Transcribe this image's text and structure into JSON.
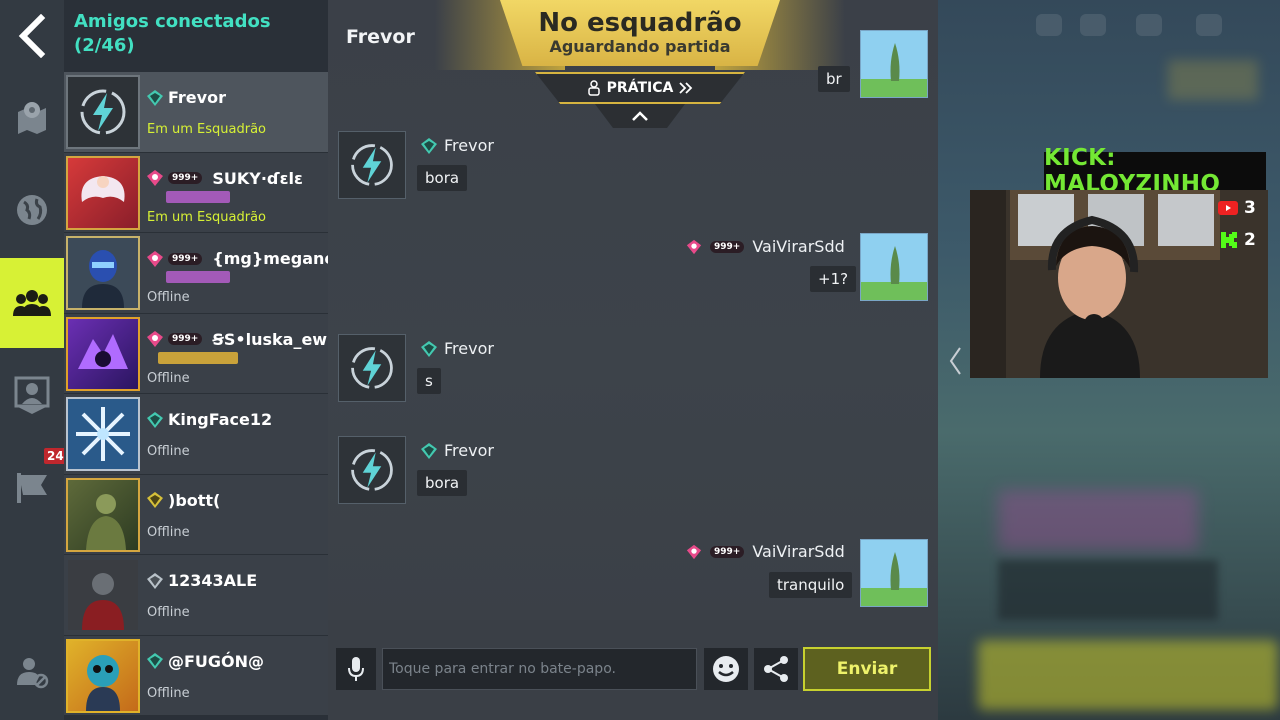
{
  "header": {
    "title": "Amigos conectados",
    "count": "(2/46)"
  },
  "friends": [
    {
      "name": "Frevor",
      "status": "Em um Esquadrão",
      "in_squad": true,
      "level": "",
      "rank_color": "#43c9b0"
    },
    {
      "name": "SUKY·ɗɛlɛ",
      "status": "Em um Esquadrão",
      "in_squad": true,
      "level": "999+",
      "rank_color": "#e84a8a"
    },
    {
      "name": "{mg}megane",
      "status": "Offline",
      "in_squad": false,
      "level": "999+",
      "rank_color": "#e84a8a"
    },
    {
      "name": "ꞨS•luska_ew",
      "status": "Offline",
      "in_squad": false,
      "level": "999+",
      "rank_color": "#e84a8a"
    },
    {
      "name": "KingFace12",
      "status": "Offline",
      "in_squad": false,
      "level": "",
      "rank_color": "#43c9b0"
    },
    {
      "name": ")bott(",
      "status": "Offline",
      "in_squad": false,
      "level": "",
      "rank_color": "#d6c03a"
    },
    {
      "name": "12343ALE",
      "status": "Offline",
      "in_squad": false,
      "level": "",
      "rank_color": "#b9c2c9"
    },
    {
      "name": "@FUGÓN@",
      "status": "Offline",
      "in_squad": false,
      "level": "",
      "rank_color": "#43c9b0"
    }
  ],
  "nav": {
    "badge": "24"
  },
  "chat": {
    "title": "Frevor",
    "squad_status": "No esquadrão",
    "squad_sub": "Aguardando partida",
    "mode": "PRÁTICA",
    "messages": [
      {
        "side": "right",
        "sender": "",
        "text": "br"
      },
      {
        "side": "left",
        "sender": "Frevor",
        "text": "bora"
      },
      {
        "side": "right",
        "sender": "VaiVirarSdd",
        "level": "999+",
        "text": "+1?"
      },
      {
        "side": "left",
        "sender": "Frevor",
        "text": "s"
      },
      {
        "side": "left",
        "sender": "Frevor",
        "text": "bora"
      },
      {
        "side": "right",
        "sender": "VaiVirarSdd",
        "level": "999+",
        "text": "tranquilo"
      }
    ],
    "input_placeholder": "Toque para entrar no bate-papo.",
    "send_label": "Enviar"
  },
  "overlay": {
    "stream_label": "KICK: MALOYZINHO",
    "youtube_count": "3",
    "kick_count": "2"
  },
  "colors": {
    "accent": "#d7f135",
    "friends_title": "#42e0c2",
    "squad_gold": "#e2c250",
    "kick_green": "#74e834"
  }
}
